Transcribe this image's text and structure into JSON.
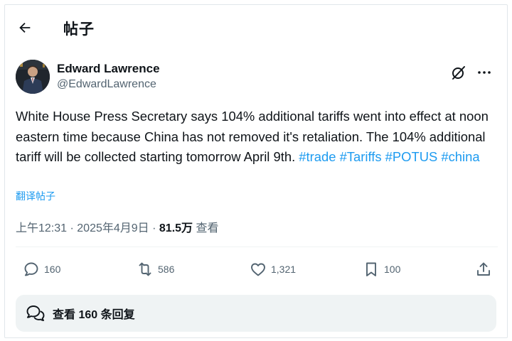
{
  "header": {
    "title": "帖子",
    "back_icon": "arrow-left-icon"
  },
  "author": {
    "name": "Edward Lawrence",
    "handle": "@EdwardLawrence"
  },
  "tweet": {
    "text_plain": "White House Press Secretary says 104% additional tariffs went into effect at noon eastern time because China has not removed it's retaliation. The 104% additional tariff will be collected starting tomorrow April 9th. ",
    "hashtags": [
      "#trade",
      "#Tariffs",
      "#POTUS",
      "#china"
    ],
    "translate_label": "翻译帖子"
  },
  "meta": {
    "time": "上午12:31",
    "separator": " · ",
    "date": "2025年4月9日",
    "separator2": " · ",
    "views_count": "81.5万",
    "views_label": "查看"
  },
  "actions": {
    "replies": "160",
    "reposts": "586",
    "likes": "1,321",
    "bookmarks": "100"
  },
  "replies_button": {
    "label": "查看 160 条回复"
  },
  "colors": {
    "text": "#0f1419",
    "secondary": "#536471",
    "accent": "#1d9bf0",
    "pill_bg": "#eff3f4"
  }
}
